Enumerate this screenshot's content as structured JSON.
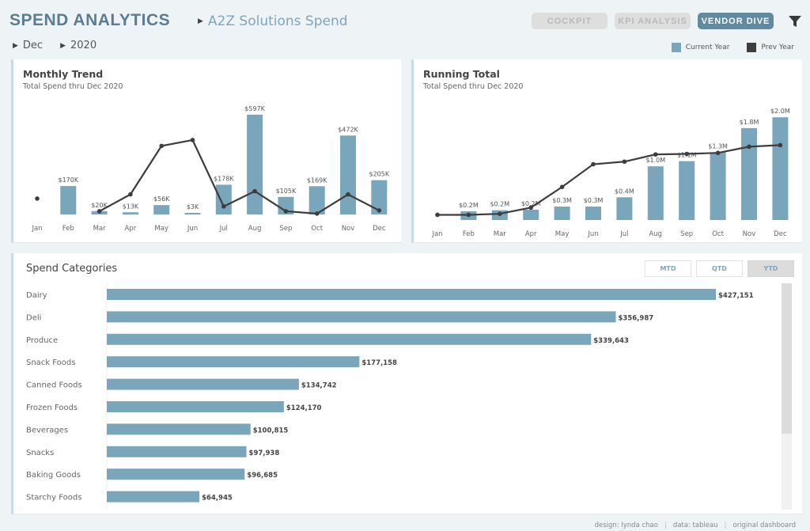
{
  "header": {
    "app_title": "SPEND ANALYTICS",
    "subtitle": "A2Z Solutions Spend",
    "filters": [
      {
        "label": "Dec"
      },
      {
        "label": "2020"
      }
    ],
    "nav": [
      {
        "label": "COCKPIT",
        "active": false
      },
      {
        "label": "KPI ANALYSIS",
        "active": false
      },
      {
        "label": "VENDOR DIVE",
        "active": true
      }
    ],
    "filter_icon": "filter-funnel-icon"
  },
  "legend": [
    {
      "label": "Current Year",
      "color": "#7aa6bc"
    },
    {
      "label": "Prev Year",
      "color": "#3d3d3d"
    }
  ],
  "colors": {
    "current": "#7aa6bc",
    "prev": "#3d3d3d"
  },
  "monthly": {
    "title": "Monthly Trend",
    "subtitle": "Total Spend thru Dec 2020"
  },
  "running": {
    "title": "Running Total",
    "subtitle": "Total Spend thru Dec 2020"
  },
  "categories_panel": {
    "title": "Spend Categories",
    "periods": [
      {
        "label": "MTD",
        "selected": false
      },
      {
        "label": "QTD",
        "selected": false
      },
      {
        "label": "YTD",
        "selected": true
      }
    ]
  },
  "chart_data": [
    {
      "id": "monthly",
      "type": "bar",
      "title": "Monthly Trend",
      "subtitle": "Total Spend thru Dec 2020",
      "categories": [
        "Jan",
        "Feb",
        "Mar",
        "Apr",
        "May",
        "Jun",
        "Jul",
        "Aug",
        "Sep",
        "Oct",
        "Nov",
        "Dec"
      ],
      "series": [
        {
          "name": "Current Year",
          "type": "bar",
          "values": [
            null,
            170,
            20,
            13,
            56,
            3,
            178,
            597,
            105,
            169,
            472,
            205
          ],
          "labels": [
            "",
            "$170K",
            "$20K",
            "$13K",
            "$56K",
            "$3K",
            "$178K",
            "$597K",
            "$105K",
            "$169K",
            "$472K",
            "$205K"
          ]
        },
        {
          "name": "Prev Year",
          "type": "line",
          "values": [
            95,
            null,
            19,
            120,
            410,
            445,
            48,
            139,
            19,
            5,
            120,
            24
          ]
        }
      ],
      "units": "K USD",
      "ylim": [
        0,
        620
      ]
    },
    {
      "id": "running",
      "type": "bar",
      "title": "Running Total",
      "subtitle": "Total Spend thru Dec 2020",
      "categories": [
        "Jan",
        "Feb",
        "Mar",
        "Apr",
        "May",
        "Jun",
        "Jul",
        "Aug",
        "Sep",
        "Oct",
        "Nov",
        "Dec"
      ],
      "series": [
        {
          "name": "Current Year",
          "type": "bar",
          "values": [
            null,
            0.17,
            0.19,
            0.2,
            0.26,
            0.26,
            0.44,
            1.04,
            1.14,
            1.31,
            1.78,
            1.99
          ],
          "labels": [
            "",
            "$0.2M",
            "$0.2M",
            "$0.2M",
            "$0.3M",
            "$0.3M",
            "$0.4M",
            "$1.0M",
            "$1.1M",
            "$1.3M",
            "$1.8M",
            "$2.0M"
          ]
        },
        {
          "name": "Prev Year",
          "type": "line",
          "values": [
            0.1,
            0.1,
            0.12,
            0.24,
            0.64,
            1.08,
            1.13,
            1.27,
            1.28,
            1.3,
            1.42,
            1.45
          ]
        }
      ],
      "units": "M USD",
      "ylim": [
        0,
        2.1
      ]
    },
    {
      "id": "categories",
      "type": "bar",
      "orientation": "horizontal",
      "title": "Spend Categories",
      "categories": [
        "Dairy",
        "Deli",
        "Produce",
        "Snack Foods",
        "Canned Foods",
        "Frozen Foods",
        "Beverages",
        "Snacks",
        "Baking Goods",
        "Starchy Foods"
      ],
      "values": [
        427151,
        356987,
        339643,
        177158,
        134742,
        124170,
        100815,
        97938,
        96685,
        64945
      ],
      "labels": [
        "$427,151",
        "$356,987",
        "$339,643",
        "$177,158",
        "$134,742",
        "$124,170",
        "$100,815",
        "$97,938",
        "$96,685",
        "$64,945"
      ]
    }
  ],
  "footer": [
    {
      "label": "design: lynda chao",
      "link": false
    },
    {
      "label": "data: tableau",
      "link": false
    },
    {
      "label": "original dashboard",
      "link": true
    }
  ]
}
